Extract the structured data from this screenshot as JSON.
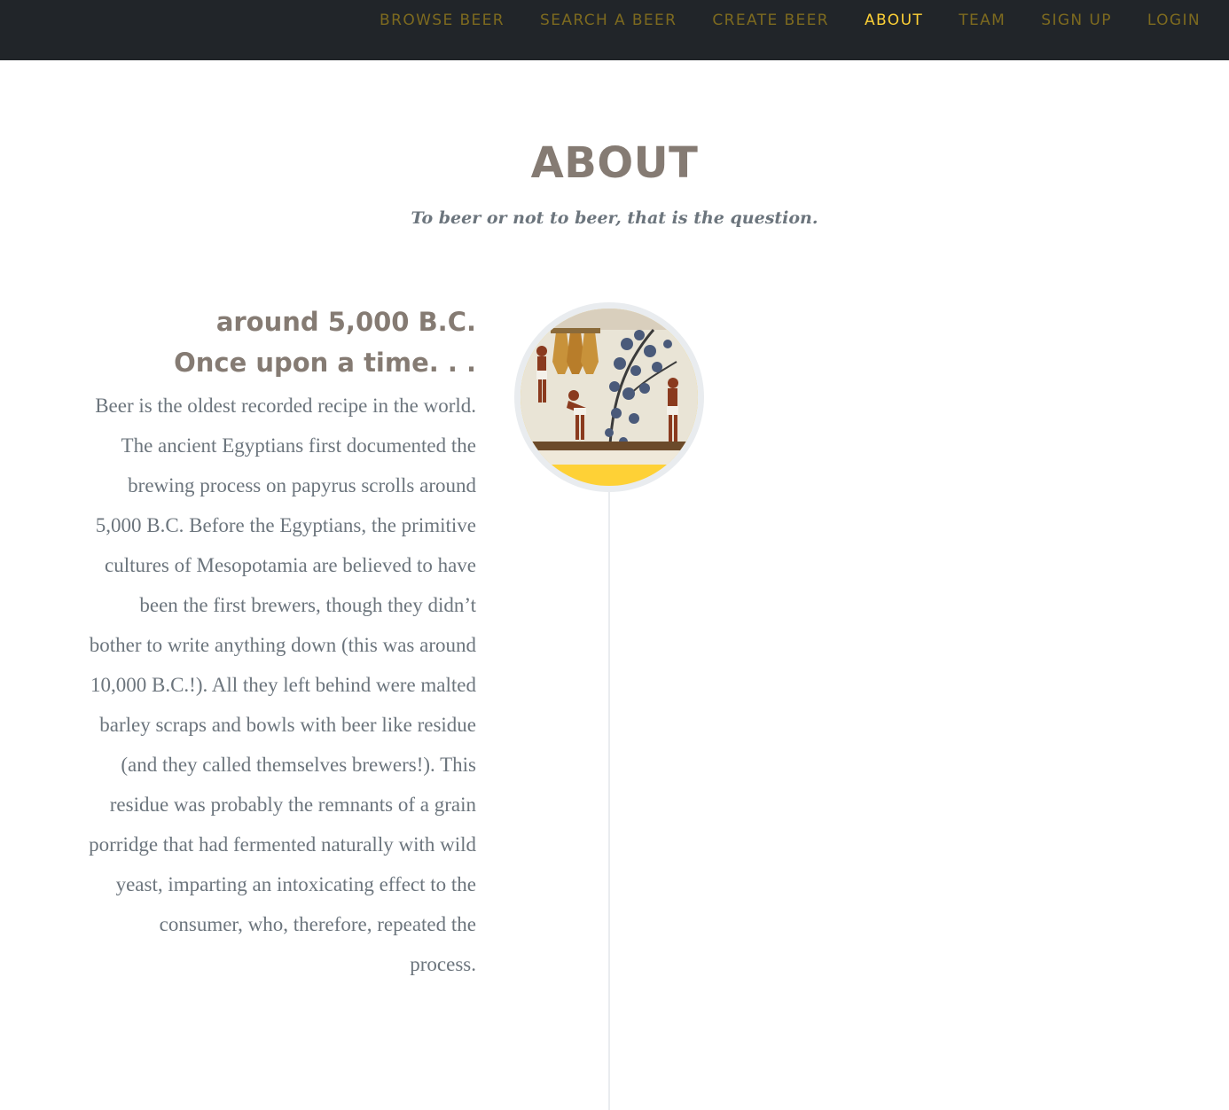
{
  "nav": {
    "items": [
      {
        "label": "BROWSE BEER",
        "active": false
      },
      {
        "label": "SEARCH A BEER",
        "active": false
      },
      {
        "label": "CREATE BEER",
        "active": false
      },
      {
        "label": "ABOUT",
        "active": true
      },
      {
        "label": "TEAM",
        "active": false
      },
      {
        "label": "SIGN UP",
        "active": false
      },
      {
        "label": "LOGIN",
        "active": false
      }
    ]
  },
  "about": {
    "title": "ABOUT",
    "subtitle": "To beer or not to beer, that is the question."
  },
  "timeline": [
    {
      "date": "around 5,000 B.C.",
      "heading": "Once upon a time. . .",
      "body": "Beer is the oldest recorded recipe in the world. The ancient Egyptians first documented the brewing process on papyrus scrolls around 5,000 B.C. Before the Egyptians, the primitive cultures of Mesopotamia are believed to have been the first brewers, though they didn’t bother to write anything down (this was around 10,000 B.C.!). All they left behind were malted barley scraps and bowls with beer like residue (and they called themselves brewers!). This residue was probably the remnants of a grain porridge that had fermented naturally with wild yeast, imparting an intoxicating effect to the consumer, who, therefore, repeated the process.",
      "image": "egyptian-brewing-mural"
    }
  ],
  "colors": {
    "navbar_bg": "#212529",
    "nav_link": "#7d6a1f",
    "nav_active": "#fed136",
    "heading": "#857b73",
    "body_text": "#6c757d",
    "accent": "#fed136"
  }
}
